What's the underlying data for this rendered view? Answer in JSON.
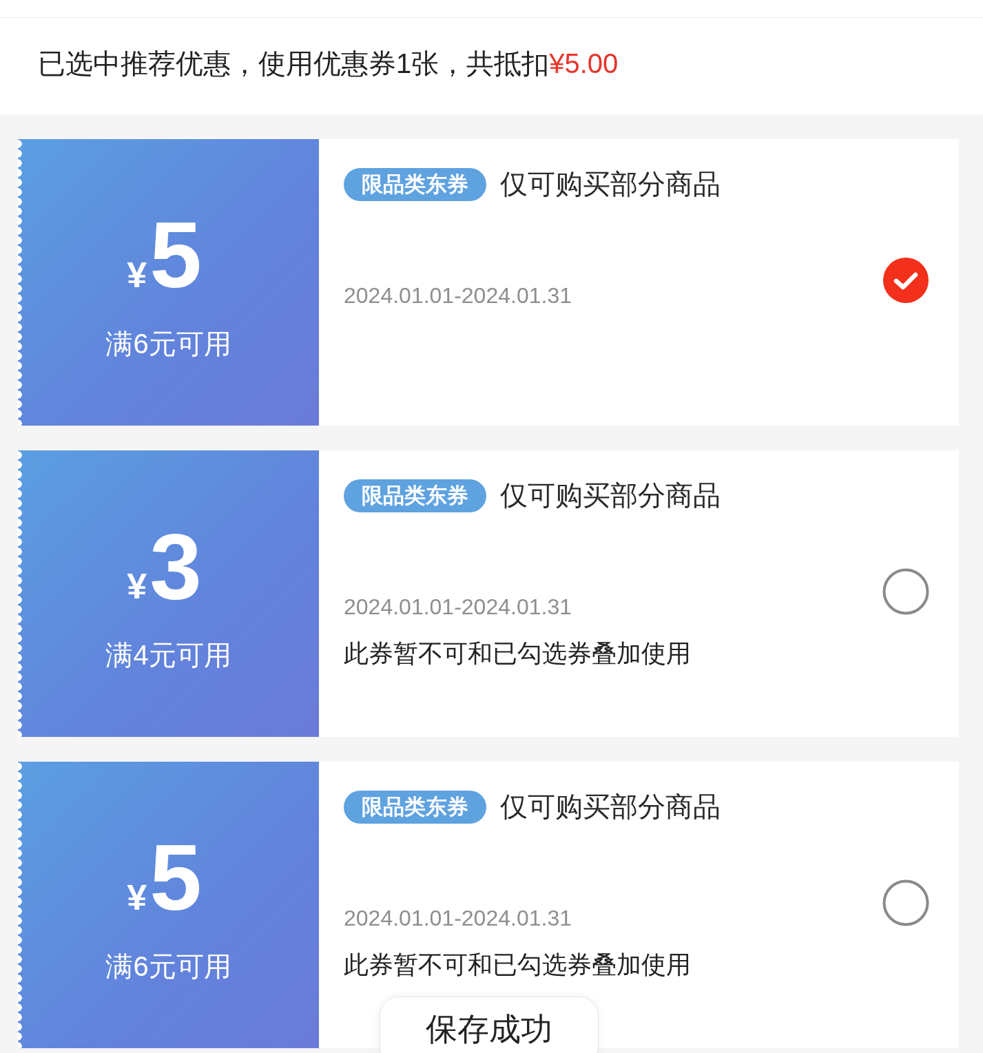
{
  "summary": {
    "text": "已选中推荐优惠，使用优惠券1张，共抵扣",
    "amount": "¥5.00"
  },
  "coupons": [
    {
      "currency": "¥",
      "amount": "5",
      "condition": "满6元可用",
      "tag": "限品类东券",
      "title": "仅可购买部分商品",
      "validity": "2024.01.01-2024.01.31",
      "selected": true
    },
    {
      "currency": "¥",
      "amount": "3",
      "condition": "满4元可用",
      "tag": "限品类东券",
      "title": "仅可购买部分商品",
      "validity": "2024.01.01-2024.01.31",
      "note": "此券暂不可和已勾选券叠加使用",
      "selected": false
    },
    {
      "currency": "¥",
      "amount": "5",
      "condition": "满6元可用",
      "tag": "限品类东券",
      "title": "仅可购买部分商品",
      "validity": "2024.01.01-2024.01.31",
      "note": "此券暂不可和已勾选券叠加使用",
      "selected": false
    }
  ],
  "toast": {
    "text": "保存成功"
  }
}
